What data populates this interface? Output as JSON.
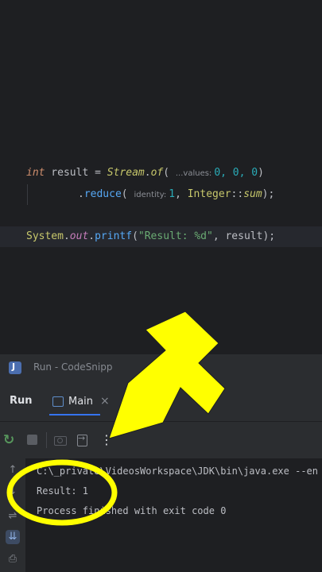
{
  "editor": {
    "line1": {
      "kw": "int",
      "var": " result = ",
      "cls": "Stream",
      "dot": ".",
      "method": "of",
      "open": "( ",
      "hint": "...values:",
      "args": "0, 0, 0",
      "close": ")"
    },
    "line2": {
      "dot": ".",
      "method": "reduce",
      "open": "( ",
      "hint": "identity:",
      "num": "1",
      "sep": ", ",
      "cls": "Integer",
      "ref": "::",
      "fn": "sum",
      "close": ");"
    },
    "line3": {
      "cls": "System",
      "dot1": ".",
      "field": "out",
      "dot2": ".",
      "method": "printf",
      "open": "(",
      "str": "\"Result: %d\"",
      "rest": ", result);"
    }
  },
  "window": {
    "title": "Run - CodeSnipp"
  },
  "run_panel": {
    "label": "Run",
    "tab_label": "Main",
    "tab_close": "×",
    "toolbar": {
      "rerun_icon": "rerun-icon",
      "stop_icon": "stop-icon",
      "screenshot_icon": "camera-icon",
      "exit_icon": "exit-icon",
      "more": "⋮"
    }
  },
  "console": {
    "lines": [
      "C:\\_private\\VideosWorkspace\\JDK\\bin\\java.exe --en",
      "Result: 1",
      "Process finished with exit code 0"
    ]
  },
  "colors": {
    "annotation": "#ffff00",
    "accent": "#3574f0"
  }
}
